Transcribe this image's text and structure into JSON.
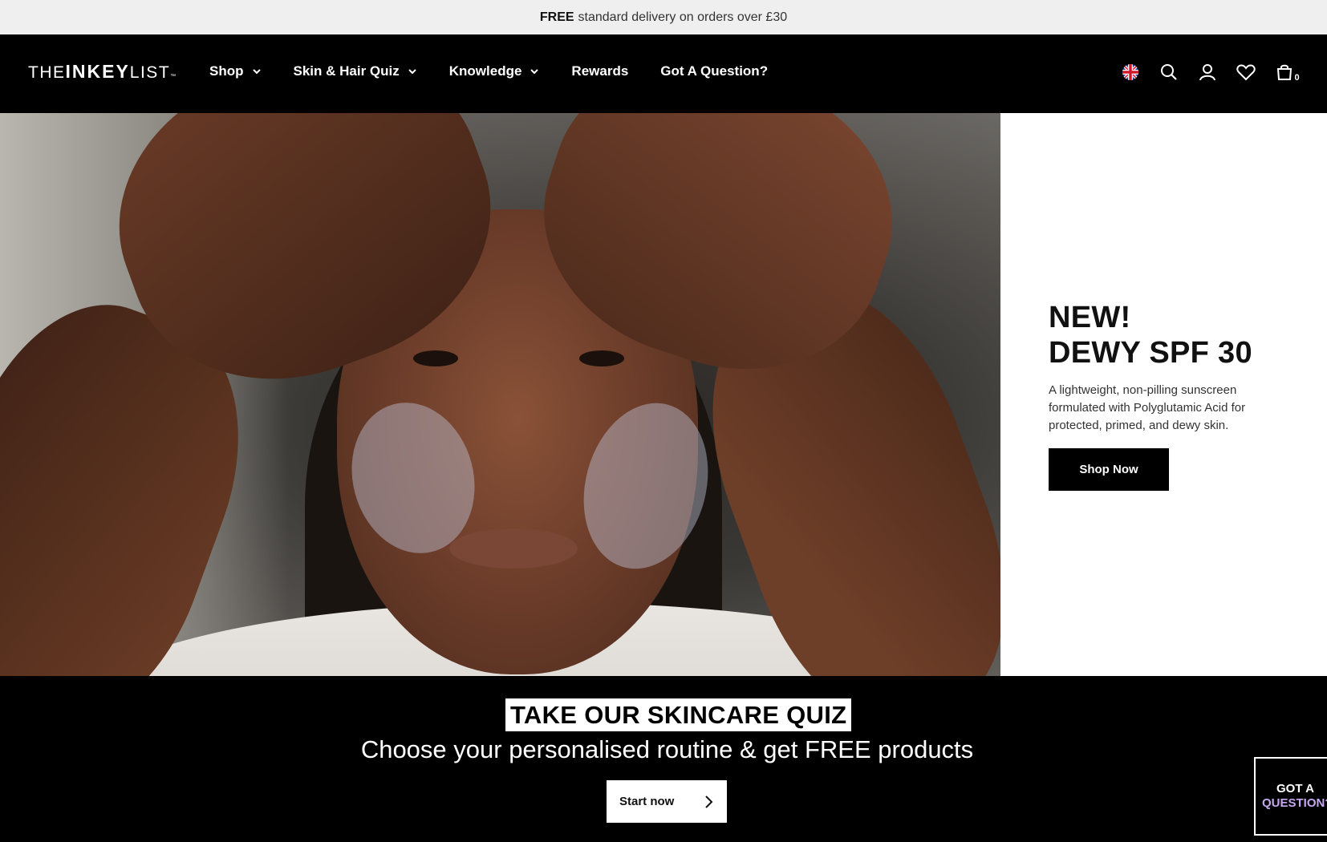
{
  "announcement": {
    "bold": "FREE",
    "text": "standard delivery on orders over £30"
  },
  "logo": {
    "part1": "THE",
    "part2": "INKEY",
    "part3": "LIST"
  },
  "nav": {
    "items": [
      {
        "label": "Shop",
        "dropdown": true
      },
      {
        "label": "Skin & Hair Quiz",
        "dropdown": true
      },
      {
        "label": "Knowledge",
        "dropdown": true
      },
      {
        "label": "Rewards",
        "dropdown": false
      },
      {
        "label": "Got A Question?",
        "dropdown": false
      }
    ],
    "icons": [
      "uk-flag-icon",
      "search-icon",
      "account-icon",
      "wishlist-heart-icon",
      "bag-icon"
    ],
    "bag_count": "0"
  },
  "promo": {
    "title_line1": "NEW!",
    "title_line2": "DEWY SPF 30",
    "description": "A lightweight, non-pilling sunscreen formulated with Polyglutamic Acid for protected, primed, and dewy skin.",
    "button_label": "Shop Now"
  },
  "quiz": {
    "title": "TAKE OUR SKINCARE QUIZ",
    "subtitle": "Choose your personalised routine & get FREE products",
    "button_label": "Start now"
  },
  "help_widget": {
    "line1": "GOT A",
    "line2": "QUESTION?"
  },
  "colors": {
    "accent_purple": "#c7a8f0",
    "nav_bg": "#000000",
    "topbar_bg": "#efefef"
  }
}
